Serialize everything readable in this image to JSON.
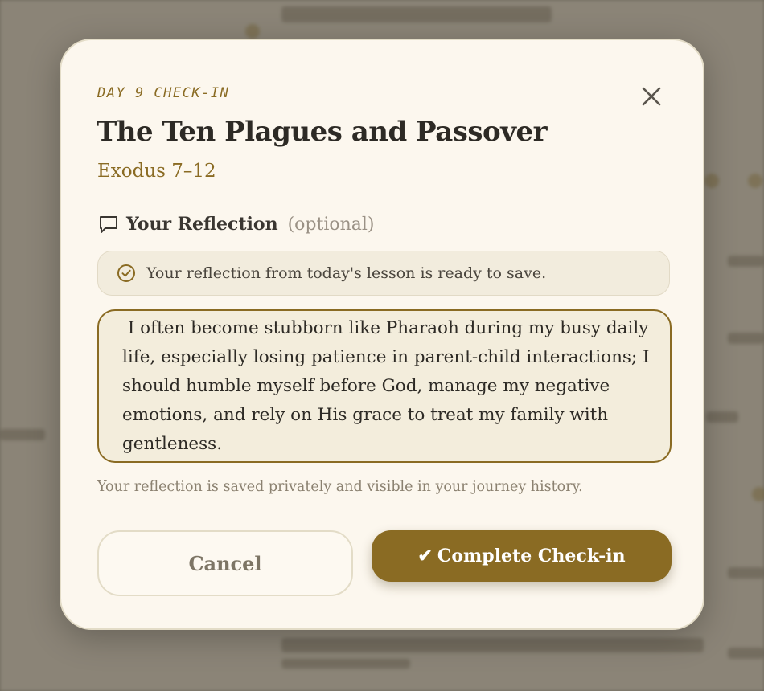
{
  "modal": {
    "eyebrow": "DAY 9 CHECK-IN",
    "title": "The Ten Plagues and Passover",
    "subtitle": "Exodus 7–12",
    "reflection_section": {
      "title": "Your Reflection",
      "optional_label": "(optional)",
      "icon": "chat-bubble-icon"
    },
    "notice": {
      "icon": "check-circle-icon",
      "text": "Your reflection from today's lesson is ready to save."
    },
    "reflection_text": " I often become stubborn like Pharaoh during my busy daily life, especially losing patience in parent-child interactions; I should humble myself before God, manage my negative emotions, and rely on His grace to treat my family with gentleness.",
    "privacy_note": "Your reflection is saved privately and visible in your journey history.",
    "cancel_label": "Cancel",
    "complete_check": "✔",
    "complete_label": "Complete Check-in",
    "close_icon": "close-icon"
  },
  "colors": {
    "accent": "#8a6b23",
    "modal_bg": "#fcf7ee",
    "text_dark": "#2d2a25",
    "muted": "#8b8170"
  }
}
